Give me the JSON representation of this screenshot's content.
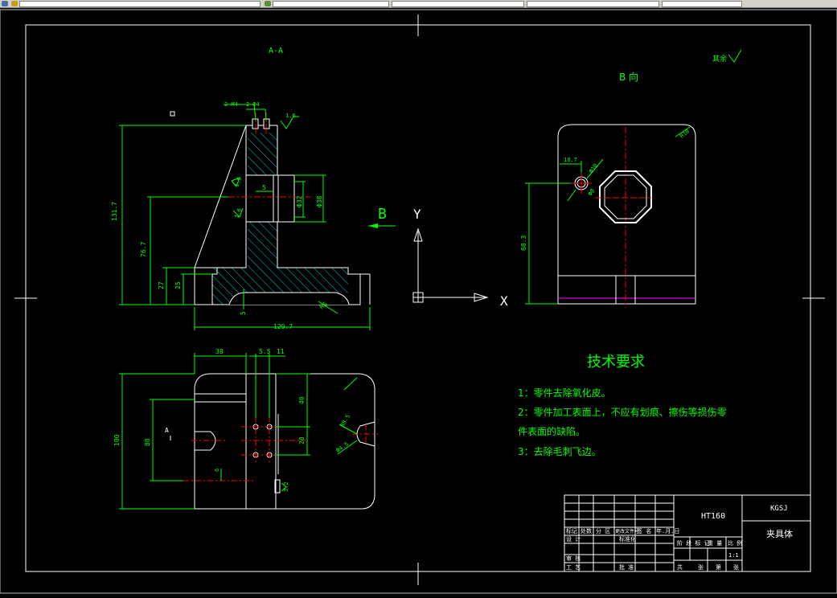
{
  "app": {
    "toolbar_icons": [
      "layer-icon",
      "color-icon",
      "linetype-icon"
    ],
    "colors": {
      "background": "#000000",
      "dimension": "#00ff00",
      "geometry": "#ffffff",
      "center": "#ff0000",
      "hatch": "#00ffff",
      "magenta": "#ff00ff",
      "text": "#00ff00"
    }
  },
  "drawing": {
    "section_label": "A-A",
    "view_b_label": "B  向",
    "roughness_note": "其余",
    "arrow_b": "B",
    "axis_y": "Y",
    "axis_x": "X",
    "section_view": {
      "leader_m4": "2-M4",
      "leader_phi4": "2-Ф4",
      "rough_top": "1.6",
      "rough_left_a": "1.6",
      "rough_left_b": "1.6",
      "dim_height_total": "131.7",
      "dim_height_mid": "76.7",
      "dim_27": "27",
      "dim_25": "25",
      "dim_5_left": "5",
      "dim_5_bottom": "5",
      "dim_phi32": "Ф32",
      "dim_phi38": "Ф38",
      "dim_r5": "R5",
      "dim_width": "129.7"
    },
    "b_view": {
      "dim_r10": "R10",
      "dim_18_7": "18.7",
      "dim_phi10": "Ф10",
      "dim_phi8": "Ф8",
      "dim_68_3": "68.3"
    },
    "plan_view": {
      "dim_38": "38",
      "dim_5_5": "5.5",
      "dim_11": "11",
      "dim_40": "40",
      "dim_20": "20",
      "dim_100": "100",
      "dim_80": "80",
      "dim_6": "6",
      "dim_r8_5": "R8.5",
      "dim_phi4_5": "Ф4.5",
      "dim_rough": "3.2",
      "label_a": "A"
    },
    "requirements": {
      "title": "技术要求",
      "items": [
        "1：零件去除氧化皮。",
        "2：零件加工表面上，不应有划痕、擦伤等损伤零",
        "件表面的缺陷。",
        "3：去除毛刺飞边。"
      ]
    },
    "title_block": {
      "material": "HT160",
      "company": "KGSJ",
      "part_name": "夹具体",
      "scale": "1:1",
      "header_row": [
        "标记",
        "处数",
        "分 区",
        "更改文件号",
        "签 名",
        "年.月.日"
      ],
      "design_label": "设 计",
      "standard_label": "标准化",
      "stage_row": [
        "阶 段 标 记",
        "重 量",
        "比 例"
      ],
      "review_label": "审 核",
      "craft_label": "工 艺",
      "approve_label": "批 准",
      "sheet_row": [
        "共",
        "张",
        "第",
        "张"
      ]
    }
  }
}
